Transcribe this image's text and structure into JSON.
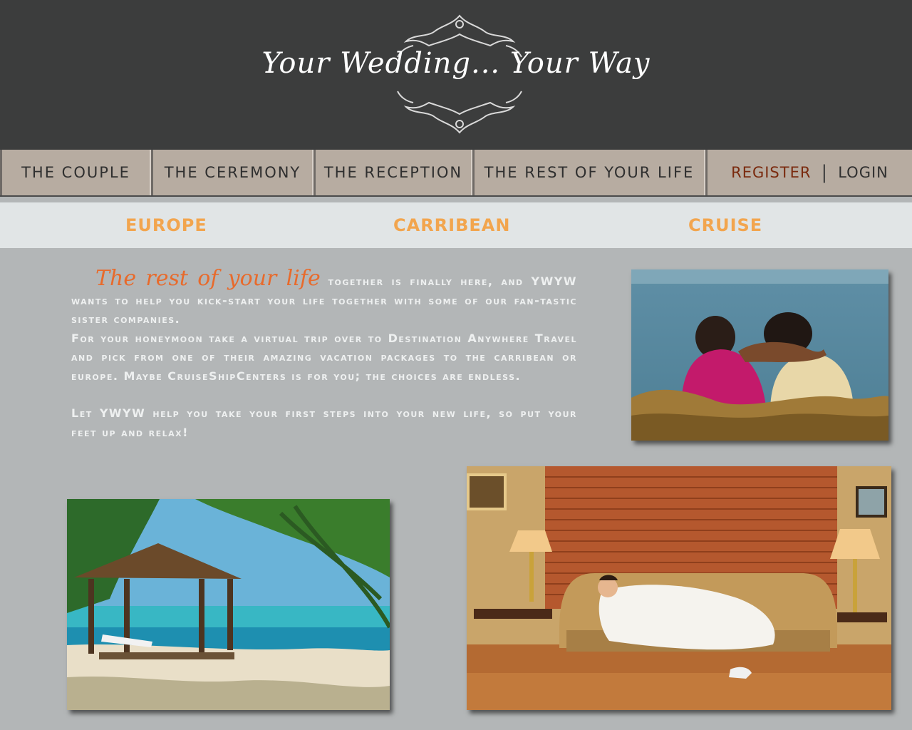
{
  "header": {
    "title": "Your Wedding... Your Way"
  },
  "nav": {
    "tabs": [
      {
        "label": "The Couple"
      },
      {
        "label": "The Ceremony"
      },
      {
        "label": "The Reception"
      },
      {
        "label": "The Rest of Your Life"
      }
    ],
    "register_label": "REGISTER",
    "divider": "|",
    "login_label": "LOGIN"
  },
  "subnav": {
    "items": [
      {
        "label": "EUROPE"
      },
      {
        "label": "CARRIBEAN"
      },
      {
        "label": "CRUISE"
      }
    ]
  },
  "content": {
    "lead": "The rest of your life",
    "para1_rest": " together is finally here, and YWYW wants to help you kick-start your life together with some of our fan-tastic sister companies.",
    "para1b": "For your honeymoon take a virtual trip over to Destination Anywhere Travel and pick from one of their amazing vacation packages to the carribean or europe. Maybe CruiseShipCenters is for you; the choices are endless.",
    "para2": "Let YWYW help you take your first steps into your new life, so put your feet up and relax!"
  },
  "colors": {
    "header_bg": "#3c3d3d",
    "nav_tab": "#b7aca1",
    "accent_orange": "#f2a54e",
    "lead_orange": "#e86a2b",
    "register_red": "#7a2a0e",
    "page_bg": "#b3b6b7"
  }
}
